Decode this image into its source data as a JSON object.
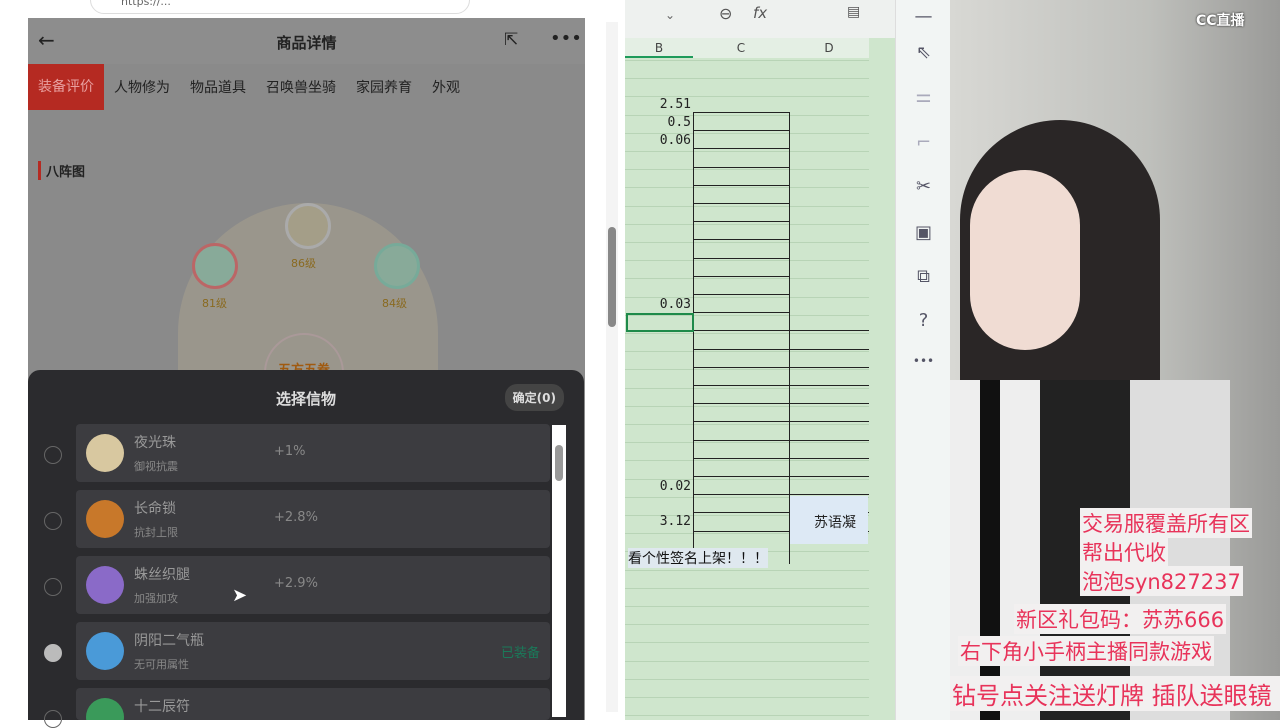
{
  "browser": {
    "url": "https://...",
    "more": "..."
  },
  "page": {
    "title": "商品详情",
    "tabs": [
      "装备评价",
      "人物修为",
      "物品道具",
      "召唤兽坐骑",
      "家园养育",
      "外观"
    ],
    "section": "八阵图",
    "diagram": {
      "levels": [
        "86级",
        "81级",
        "84级"
      ],
      "center": "五方五卷"
    }
  },
  "modal": {
    "title": "选择信物",
    "confirm": "确定(0)",
    "items": [
      {
        "name": "夜光珠",
        "sub": "御视抗震",
        "bonus": "+1%",
        "status": ""
      },
      {
        "name": "长命锁",
        "sub": "抗封上限",
        "bonus": "+2.8%",
        "status": ""
      },
      {
        "name": "蛛丝织腿",
        "sub": "加强加攻",
        "bonus": "+2.9%",
        "status": ""
      },
      {
        "name": "阴阳二气瓶",
        "sub": "无可用属性",
        "bonus": "",
        "status": "已装备"
      },
      {
        "name": "十二辰符",
        "sub": "",
        "bonus": "",
        "status": ""
      }
    ]
  },
  "sheet": {
    "cols": [
      "B",
      "C",
      "D"
    ],
    "values": [
      "2.51",
      "0.5",
      "0.06",
      "0.03",
      "0.02",
      "3.12"
    ],
    "d_text": "苏语凝",
    "note": "看个性签名上架！！！"
  },
  "stream": {
    "logo": "CC直播",
    "overlay": [
      "交易服覆盖所有区",
      "帮出代收",
      "泡泡syn827237",
      "新区礼包码：苏苏666",
      "右下角小手柄主播同款游戏",
      "钻号点关注送灯牌 插队送眼镜"
    ]
  }
}
